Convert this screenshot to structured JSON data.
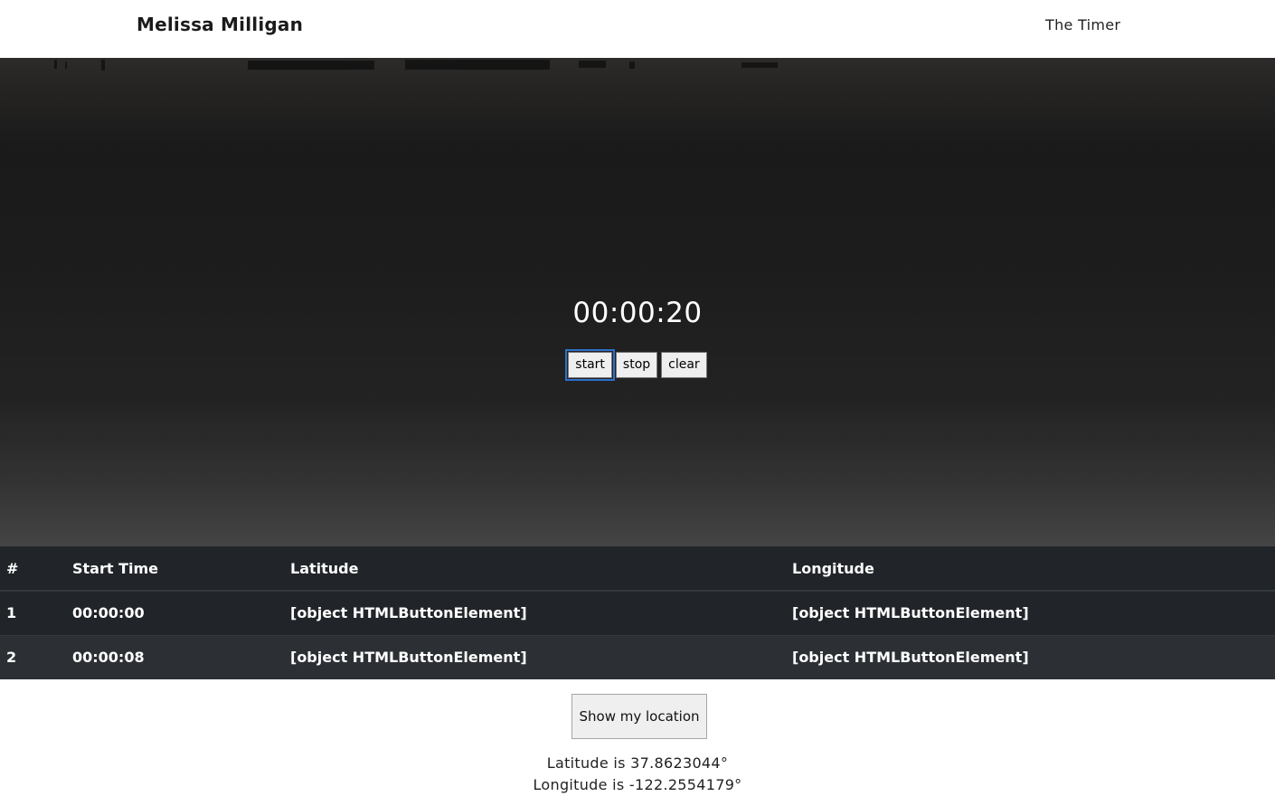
{
  "header": {
    "brand": "Melissa Milligan",
    "nav_link": "The Timer"
  },
  "timer": {
    "display": "00:00:20",
    "buttons": {
      "start": "start",
      "stop": "stop",
      "clear": "clear"
    }
  },
  "laps_table": {
    "headers": [
      "#",
      "Start Time",
      "Latitude",
      "Longitude"
    ],
    "rows": [
      [
        "1",
        "00:00:00",
        "[object HTMLButtonElement]",
        "[object HTMLButtonElement]"
      ],
      [
        "2",
        "00:00:08",
        "[object HTMLButtonElement]",
        "[object HTMLButtonElement]"
      ]
    ]
  },
  "location": {
    "button_label": "Show my location",
    "latitude_text": "Latitude is 37.8623044°",
    "longitude_text": "Longitude is -122.2554179°"
  },
  "colors": {
    "table_header_bg": "#212529",
    "table_stripe_bg": "#2c3034",
    "focus_ring": "#2f6fcb"
  }
}
